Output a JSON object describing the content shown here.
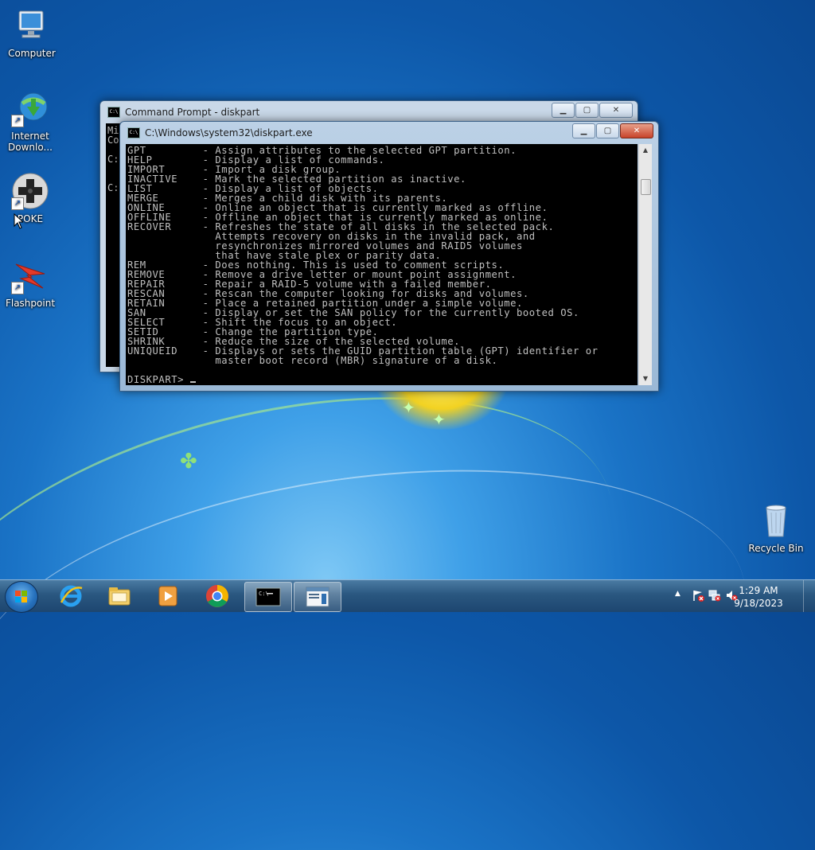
{
  "desktop": {
    "icons": [
      {
        "label": "Computer",
        "icon": "computer-icon"
      },
      {
        "label": "Internet Downlo...",
        "label_line1": "Internet",
        "label_line2": "Downlo...",
        "icon": "internet-download-manager-icon"
      },
      {
        "label": "POKE",
        "icon": "gamepad-icon"
      },
      {
        "label": "Flashpoint",
        "icon": "flashpoint-icon"
      },
      {
        "label": "Recycle Bin",
        "icon": "recycle-bin-icon"
      }
    ]
  },
  "back_window": {
    "title": "Command Prompt - diskpart",
    "visible_text": [
      "Mi",
      "Co",
      "C:",
      "C:"
    ]
  },
  "front_window": {
    "title": "C:\\Windows\\system32\\diskpart.exe",
    "commands": [
      {
        "name": "GPT",
        "desc": [
          "Assign attributes to the selected GPT partition."
        ]
      },
      {
        "name": "HELP",
        "desc": [
          "Display a list of commands."
        ]
      },
      {
        "name": "IMPORT",
        "desc": [
          "Import a disk group."
        ]
      },
      {
        "name": "INACTIVE",
        "desc": [
          "Mark the selected partition as inactive."
        ]
      },
      {
        "name": "LIST",
        "desc": [
          "Display a list of objects."
        ]
      },
      {
        "name": "MERGE",
        "desc": [
          "Merges a child disk with its parents."
        ]
      },
      {
        "name": "ONLINE",
        "desc": [
          "Online an object that is currently marked as offline."
        ]
      },
      {
        "name": "OFFLINE",
        "desc": [
          "Offline an object that is currently marked as online."
        ]
      },
      {
        "name": "RECOVER",
        "desc": [
          "Refreshes the state of all disks in the selected pack.",
          "Attempts recovery on disks in the invalid pack, and",
          "resynchronizes mirrored volumes and RAID5 volumes",
          "that have stale plex or parity data."
        ]
      },
      {
        "name": "REM",
        "desc": [
          "Does nothing. This is used to comment scripts."
        ]
      },
      {
        "name": "REMOVE",
        "desc": [
          "Remove a drive letter or mount point assignment."
        ]
      },
      {
        "name": "REPAIR",
        "desc": [
          "Repair a RAID-5 volume with a failed member."
        ]
      },
      {
        "name": "RESCAN",
        "desc": [
          "Rescan the computer looking for disks and volumes."
        ]
      },
      {
        "name": "RETAIN",
        "desc": [
          "Place a retained partition under a simple volume."
        ]
      },
      {
        "name": "SAN",
        "desc": [
          "Display or set the SAN policy for the currently booted OS."
        ]
      },
      {
        "name": "SELECT",
        "desc": [
          "Shift the focus to an object."
        ]
      },
      {
        "name": "SETID",
        "desc": [
          "Change the partition type."
        ]
      },
      {
        "name": "SHRINK",
        "desc": [
          "Reduce the size of the selected volume."
        ]
      },
      {
        "name": "UNIQUEID",
        "desc": [
          "Displays or sets the GUID partition table (GPT) identifier or",
          "master boot record (MBR) signature of a disk."
        ]
      }
    ],
    "prompt": "DISKPART> "
  },
  "taskbar": {
    "items": [
      {
        "icon": "internet-explorer-icon"
      },
      {
        "icon": "file-explorer-icon"
      },
      {
        "icon": "media-player-icon"
      },
      {
        "icon": "chrome-icon"
      },
      {
        "icon": "command-prompt-icon",
        "active": true
      },
      {
        "icon": "window-app-icon",
        "active": true
      }
    ],
    "time": "1:29 AM",
    "date": "9/18/2023"
  },
  "colors": {
    "console_bg": "#000000",
    "console_fg": "#c0c0c0",
    "close_button": "#c7432a"
  }
}
